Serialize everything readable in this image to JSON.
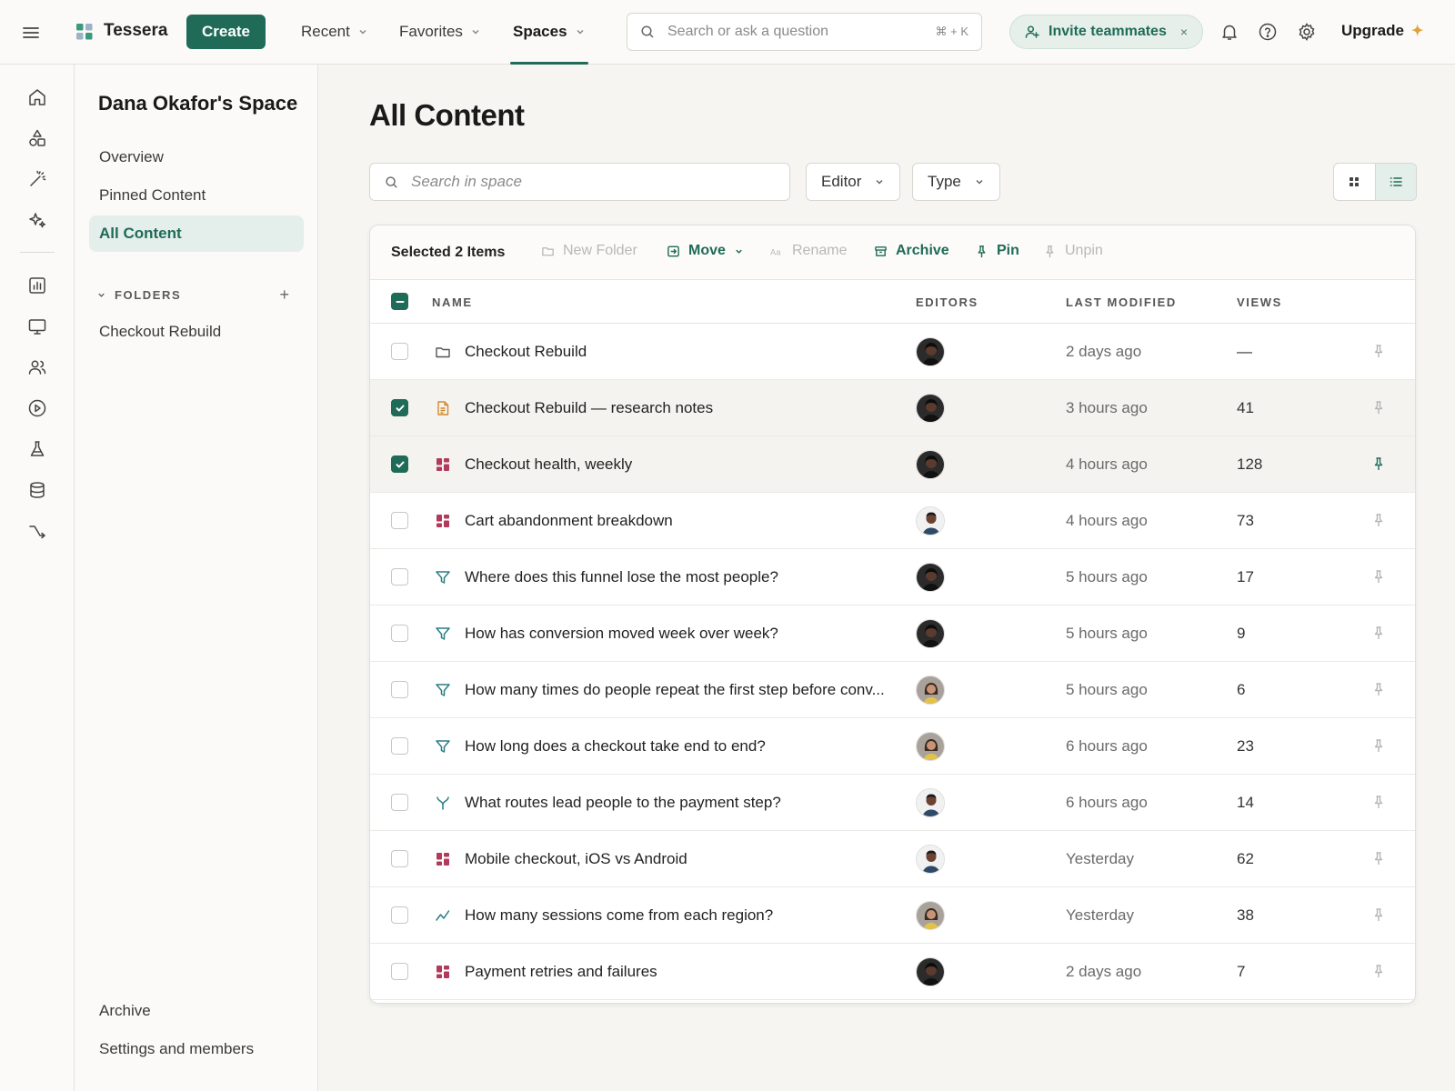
{
  "colors": {
    "accent": "#1f6b58",
    "dashboard": "#b23a5a",
    "doc": "#d28a2c",
    "funnel": "#2a7d86"
  },
  "topbar": {
    "brand": "Tessera",
    "create_label": "Create",
    "nav": [
      {
        "label": "Recent",
        "active": false
      },
      {
        "label": "Favorites",
        "active": false
      },
      {
        "label": "Spaces",
        "active": true
      }
    ],
    "search_placeholder": "Search or ask a question",
    "search_shortcut": "⌘ + K",
    "invite_label": "Invite teammates",
    "invite_close": "×",
    "upgrade_label": "Upgrade",
    "upgrade_spark": "✦"
  },
  "sidebar": {
    "space_title": "Dana Okafor's Space",
    "items": [
      {
        "label": "Overview",
        "active": false
      },
      {
        "label": "Pinned Content",
        "active": false
      },
      {
        "label": "All Content",
        "active": true
      }
    ],
    "folders_label": "FOLDERS",
    "folders_add": "+",
    "folders": [
      {
        "label": "Checkout Rebuild"
      }
    ],
    "footer": [
      {
        "label": "Archive"
      },
      {
        "label": "Settings and members"
      }
    ]
  },
  "main": {
    "title": "All Content",
    "search_placeholder": "Search in space",
    "filters": [
      {
        "label": "Editor"
      },
      {
        "label": "Type"
      }
    ],
    "toolbar": {
      "selection": "Selected 2 Items",
      "actions": [
        {
          "label": "New Folder",
          "enabled": false,
          "icon": "folder-icon"
        },
        {
          "label": "Move",
          "enabled": true,
          "icon": "move-icon"
        },
        {
          "label": "Rename",
          "enabled": false,
          "icon": "rename-icon"
        },
        {
          "label": "Archive",
          "enabled": true,
          "icon": "archive-icon"
        },
        {
          "label": "Pin",
          "enabled": true,
          "icon": "pin-icon"
        },
        {
          "label": "Unpin",
          "enabled": false,
          "icon": "unpin-icon"
        }
      ]
    },
    "columns": {
      "name": "NAME",
      "editors": "EDITORS",
      "modified": "LAST MODIFIED",
      "views": "VIEWS"
    },
    "rows": [
      {
        "type": "folder",
        "name": "Checkout Rebuild",
        "editor": "dark",
        "modified": "2 days ago",
        "views": "—",
        "checked": false,
        "pinned": false
      },
      {
        "type": "doc",
        "name": "Checkout Rebuild — research notes",
        "editor": "dark",
        "modified": "3 hours ago",
        "views": "41",
        "checked": true,
        "pinned": false
      },
      {
        "type": "dashboard",
        "name": "Checkout health, weekly",
        "editor": "dark",
        "modified": "4 hours ago",
        "views": "128",
        "checked": true,
        "pinned": true
      },
      {
        "type": "dashboard",
        "name": "Cart abandonment breakdown",
        "editor": "man",
        "modified": "4 hours ago",
        "views": "73",
        "checked": false,
        "pinned": false
      },
      {
        "type": "funnel",
        "name": "Where does this funnel lose the most people?",
        "editor": "dark",
        "modified": "5 hours ago",
        "views": "17",
        "checked": false,
        "pinned": false
      },
      {
        "type": "funnel",
        "name": "How has conversion moved week over week?",
        "editor": "dark",
        "modified": "5 hours ago",
        "views": "9",
        "checked": false,
        "pinned": false
      },
      {
        "type": "funnel",
        "name": "How many times do people repeat the first step before conv...",
        "editor": "woman",
        "modified": "5 hours ago",
        "views": "6",
        "checked": false,
        "pinned": false
      },
      {
        "type": "funnel",
        "name": "How long does a checkout take end to end?",
        "editor": "woman",
        "modified": "6 hours ago",
        "views": "23",
        "checked": false,
        "pinned": false
      },
      {
        "type": "flows",
        "name": "What routes lead people to the payment step?",
        "editor": "man",
        "modified": "6 hours ago",
        "views": "14",
        "checked": false,
        "pinned": false
      },
      {
        "type": "dashboard",
        "name": "Mobile checkout, iOS vs Android",
        "editor": "man",
        "modified": "Yesterday",
        "views": "62",
        "checked": false,
        "pinned": false
      },
      {
        "type": "insight",
        "name": "How many sessions come from each region?",
        "editor": "woman",
        "modified": "Yesterday",
        "views": "38",
        "checked": false,
        "pinned": false
      },
      {
        "type": "dashboard",
        "name": "Payment retries and failures",
        "editor": "dark",
        "modified": "2 days ago",
        "views": "7",
        "checked": false,
        "pinned": false
      }
    ]
  }
}
